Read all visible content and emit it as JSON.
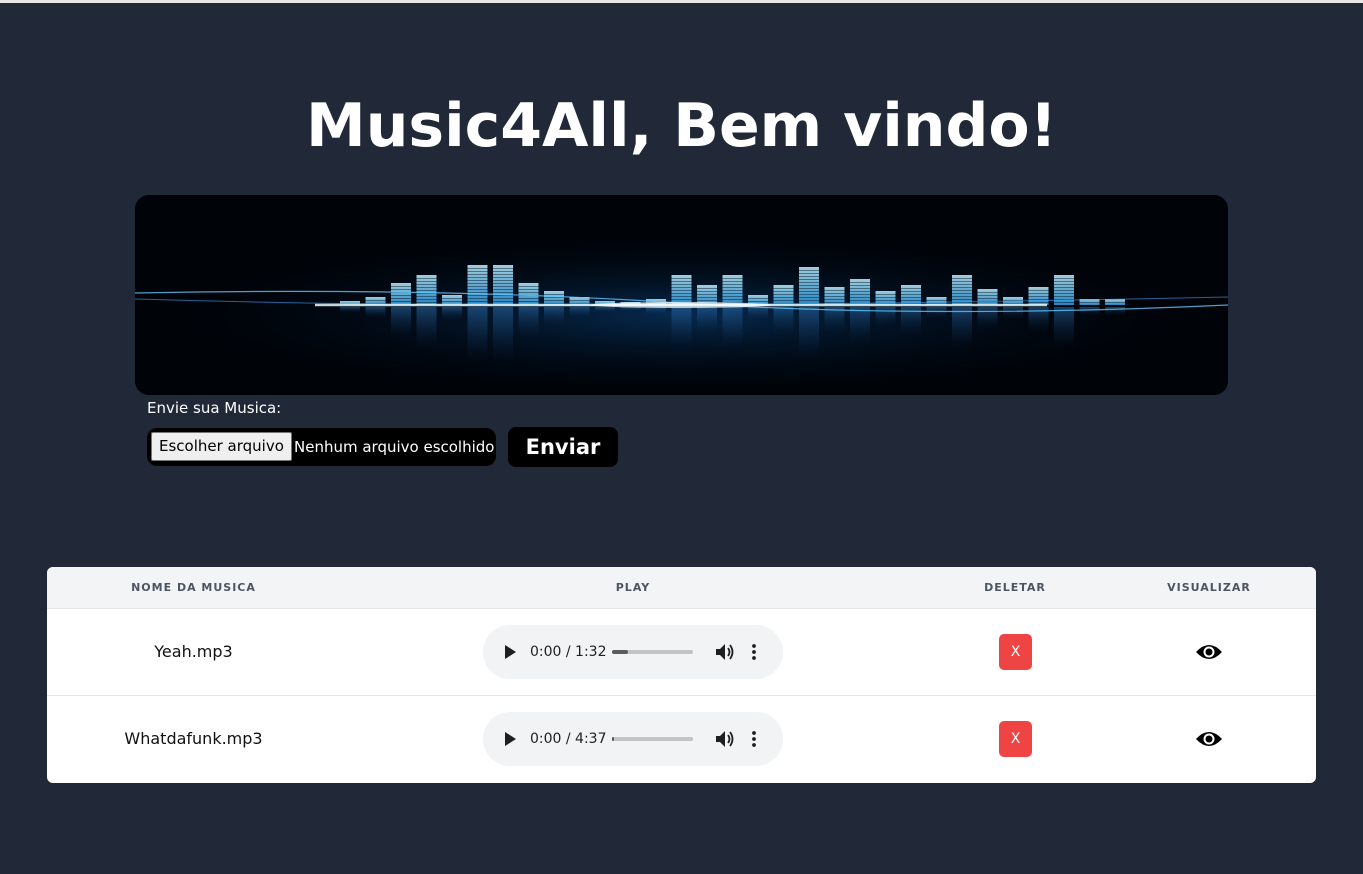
{
  "header": {
    "title": "Music4All, Bem vindo!"
  },
  "banner": {
    "icon": "equalizer-banner-image"
  },
  "upload": {
    "label": "Envie sua Musica:",
    "file_button_label": "Escolher arquivo",
    "file_status": "Nenhum arquivo escolhido",
    "submit_label": "Enviar"
  },
  "table": {
    "columns": [
      "NOME DA MUSICA",
      "PLAY",
      "DELETAR",
      "VISUALIZAR"
    ],
    "rows": [
      {
        "name": "Yeah.mp3",
        "time": "0:00 / 1:32",
        "progress": 0.2,
        "delete_label": "X"
      },
      {
        "name": "Whatdafunk.mp3",
        "time": "0:00 / 4:37",
        "progress": 0.0,
        "delete_label": "X"
      }
    ]
  },
  "colors": {
    "background": "#212938",
    "delete": "#ef4444",
    "equalizer": "#4cc3ff"
  }
}
